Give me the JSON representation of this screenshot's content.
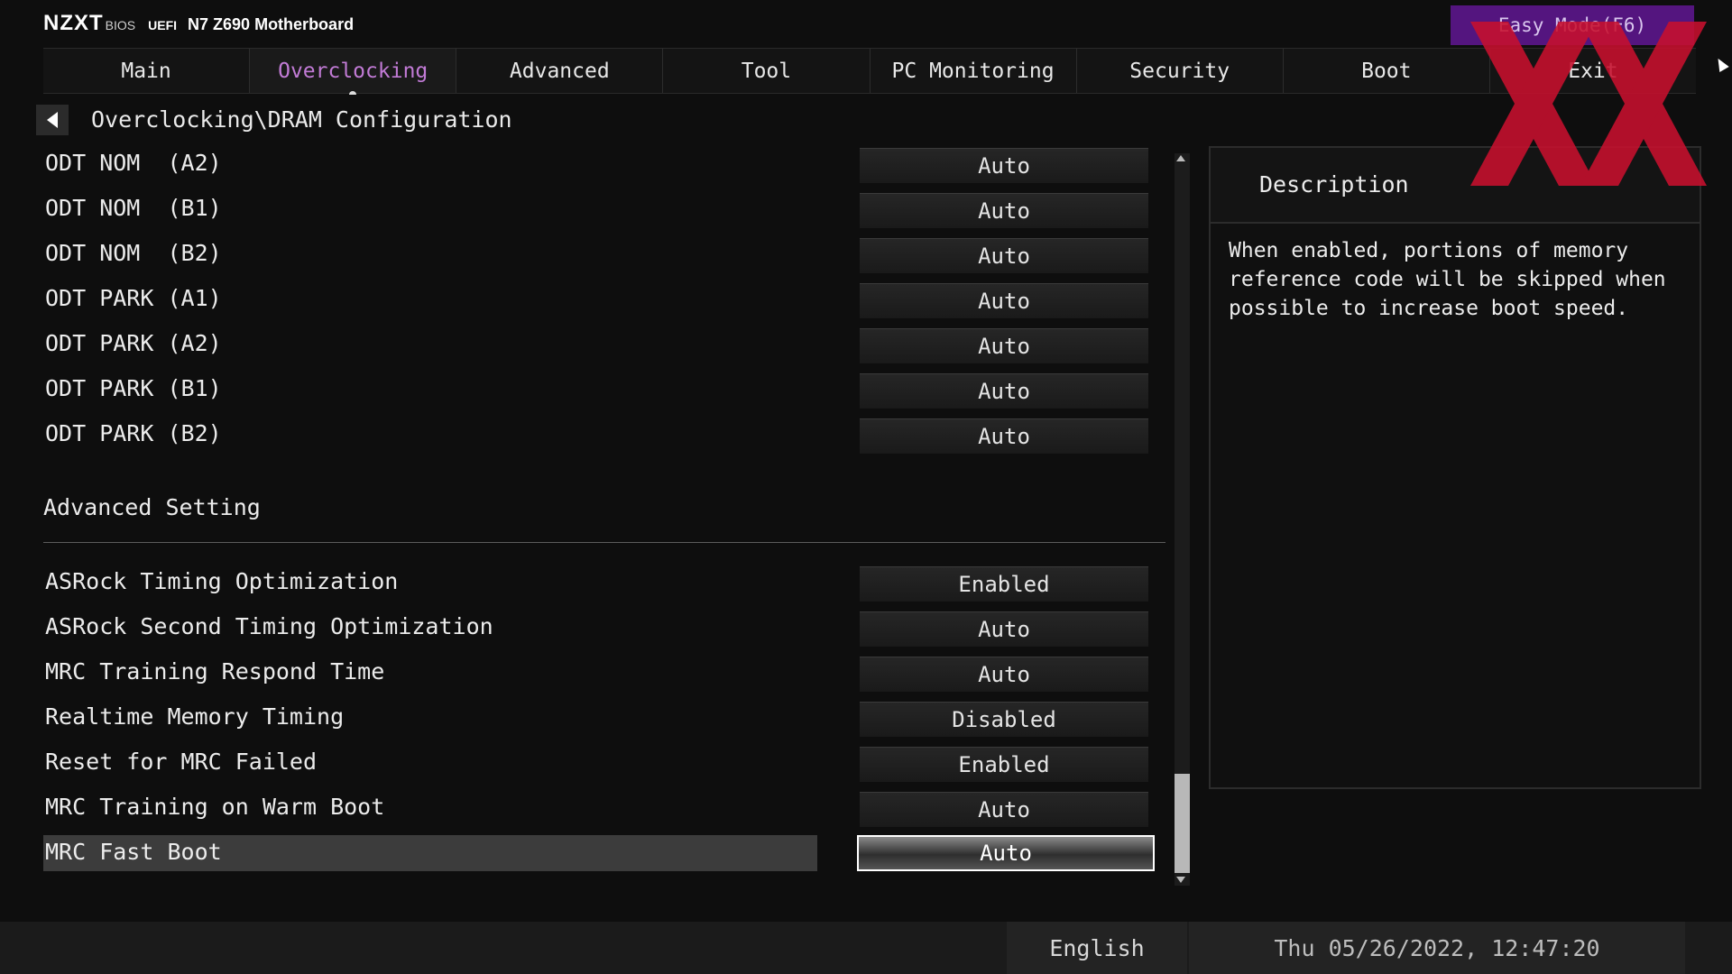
{
  "header": {
    "logo": "NZXT",
    "bios": "BIOS",
    "uefi": "UEFI",
    "model": "N7 Z690 Motherboard",
    "easy_mode": "Easy Mode(F6)"
  },
  "tabs": [
    {
      "label": "Main"
    },
    {
      "label": "Overclocking",
      "active": true
    },
    {
      "label": "Advanced"
    },
    {
      "label": "Tool"
    },
    {
      "label": "PC Monitoring"
    },
    {
      "label": "Security"
    },
    {
      "label": "Boot"
    },
    {
      "label": "Exit"
    }
  ],
  "breadcrumb": "Overclocking\\DRAM Configuration",
  "settings_top": [
    {
      "label": "ODT NOM  (A2)",
      "value": "Auto"
    },
    {
      "label": "ODT NOM  (B1)",
      "value": "Auto"
    },
    {
      "label": "ODT NOM  (B2)",
      "value": "Auto"
    },
    {
      "label": "ODT PARK (A1)",
      "value": "Auto"
    },
    {
      "label": "ODT PARK (A2)",
      "value": "Auto"
    },
    {
      "label": "ODT PARK (B1)",
      "value": "Auto"
    },
    {
      "label": "ODT PARK (B2)",
      "value": "Auto"
    }
  ],
  "section_title": "Advanced Setting",
  "settings_bottom": [
    {
      "label": "ASRock Timing Optimization",
      "value": "Enabled"
    },
    {
      "label": "ASRock Second Timing Optimization",
      "value": "Auto"
    },
    {
      "label": "MRC Training Respond Time",
      "value": "Auto"
    },
    {
      "label": "Realtime Memory Timing",
      "value": "Disabled"
    },
    {
      "label": "Reset for MRC Failed",
      "value": "Enabled"
    },
    {
      "label": "MRC Training on Warm Boot",
      "value": "Auto"
    },
    {
      "label": "MRC Fast Boot",
      "value": "Auto",
      "selected": true
    }
  ],
  "description": {
    "title": "Description",
    "text": "When enabled, portions of memory reference code will be skipped when possible to increase boot speed."
  },
  "footer": {
    "language": "English",
    "datetime": "Thu 05/26/2022, 12:47:20"
  },
  "colors": {
    "accent": "#c27bd6",
    "easy_mode_bg": "#54157f",
    "watermark": "#c8102e"
  },
  "icons": {
    "back": "back-arrow-icon",
    "scroll_up": "scroll-up-arrow-icon",
    "scroll_down": "scroll-down-arrow-icon",
    "watermark": "xx-watermark-logo"
  }
}
